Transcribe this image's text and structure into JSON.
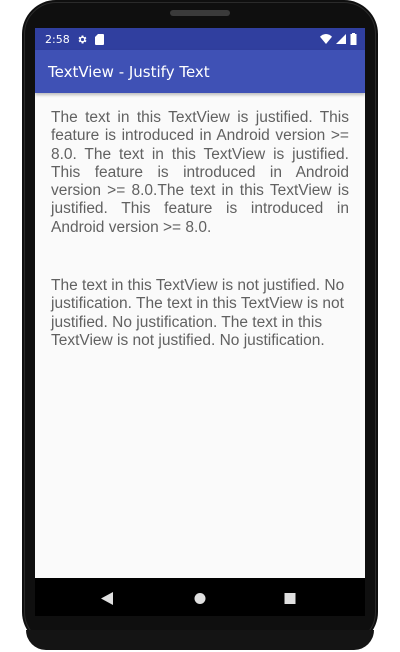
{
  "status_bar": {
    "time": "2:58",
    "icons": [
      "gear-icon",
      "sd-card-icon",
      "wifi-icon",
      "cellular-signal-icon",
      "battery-icon"
    ]
  },
  "app_bar": {
    "title": "TextView - Justify Text"
  },
  "content": {
    "justified_text": "The text in this TextView is justified. This feature is introduced in Android version >= 8.0. The text in this TextView is justified. This feature is introduced in Android version >= 8.0.The text in this TextView is justified. This feature is introduced in Android version >= 8.0.",
    "not_justified_text": "The text in this TextView is not justified. No justification. The text in this TextView is not justified. No justification. The text in this TextView is not justified. No justification."
  },
  "nav_bar": {
    "icons": [
      "back-icon",
      "home-icon",
      "recents-icon"
    ]
  },
  "colors": {
    "status_bar": "#303f9f",
    "app_bar": "#3f51b5",
    "text": "#616161",
    "background": "#fafafa"
  }
}
